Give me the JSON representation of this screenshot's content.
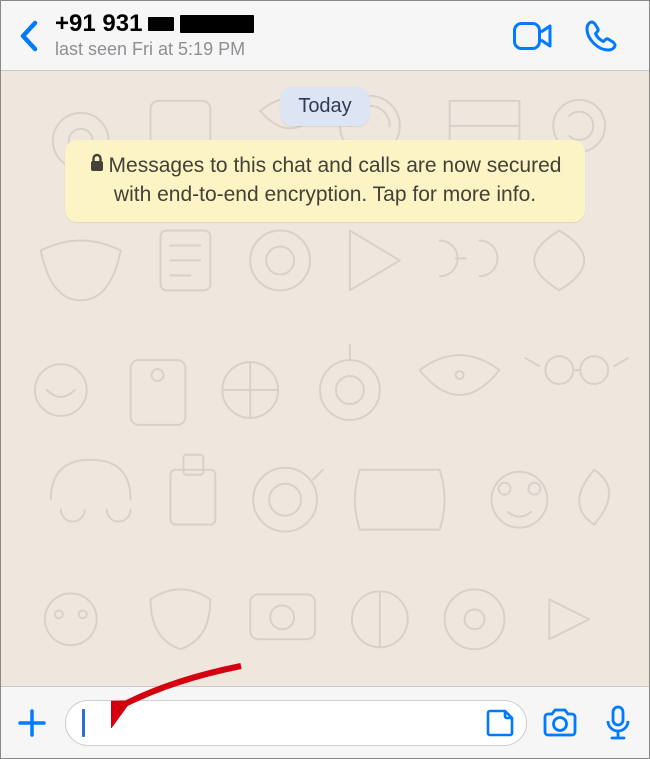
{
  "header": {
    "contact_phone": "+91 931",
    "last_seen": "last seen Fri at 5:19 PM"
  },
  "chat": {
    "date_chip": "Today",
    "encryption_notice": "Messages to this chat and calls are now secured with end-to-end encryption. Tap for more info."
  },
  "input": {
    "value": ""
  },
  "colors": {
    "accent": "#007aff",
    "banner_bg": "#fdf4c5",
    "chip_bg": "#dde4f3",
    "chat_bg": "#efe7de"
  }
}
